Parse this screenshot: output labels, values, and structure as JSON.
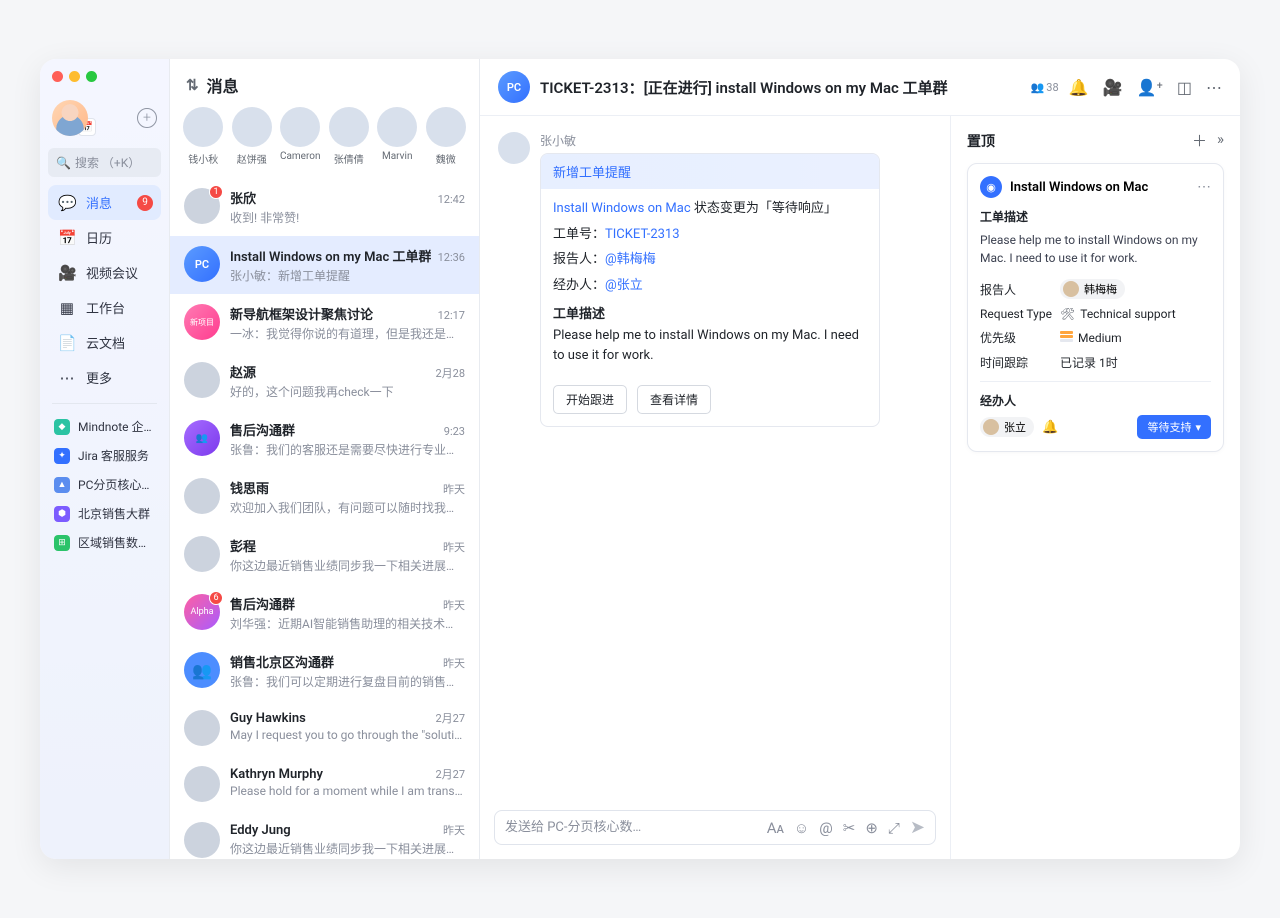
{
  "nav": {
    "search_placeholder": "搜索 （+K）",
    "items": [
      {
        "label": "消息",
        "icon": "💬",
        "badge": "9",
        "active": true
      },
      {
        "label": "日历",
        "icon": "📅"
      },
      {
        "label": "视频会议",
        "icon": "🎥"
      },
      {
        "label": "工作台",
        "icon": "▦"
      },
      {
        "label": "云文档",
        "icon": "📄"
      },
      {
        "label": "更多",
        "icon": "⋯"
      }
    ],
    "apps": [
      {
        "label": "Mindnote 企…",
        "color": "#2bc3a3",
        "ch": "◆"
      },
      {
        "label": "Jira 客服服务",
        "color": "#3370ff",
        "ch": "✦"
      },
      {
        "label": "PC分页核心…",
        "color": "#5b8def",
        "ch": "▲"
      },
      {
        "label": "北京销售大群",
        "color": "#7c5cff",
        "ch": "⬢"
      },
      {
        "label": "区域销售数…",
        "color": "#2bc36a",
        "ch": "⊞"
      }
    ]
  },
  "convos": {
    "header": "消息",
    "stories": [
      {
        "name": "钱小秋"
      },
      {
        "name": "赵饼强"
      },
      {
        "name": "Cameron"
      },
      {
        "name": "张倩倩"
      },
      {
        "name": "Marvin"
      },
      {
        "name": "魏微"
      }
    ],
    "list": [
      {
        "avatar": "p",
        "badge": "1",
        "title": "张欣",
        "time": "12:42",
        "sub": "收到! 非常赞!"
      },
      {
        "avatar": "pc",
        "pcText": "PC",
        "title": "Install Windows on my Mac 工单群",
        "time": "12:36",
        "sub": "张小敏：新增工单提醒",
        "active": true
      },
      {
        "avatar": "pink",
        "pcText": "新项目",
        "title": "新导航框架设计聚焦讨论",
        "time": "12:17",
        "sub": "一冰：我觉得你说的有道理，但是我还是坚持…"
      },
      {
        "avatar": "p",
        "title": "赵源",
        "time": "2月28",
        "sub": "好的，这个问题我再check一下"
      },
      {
        "avatar": "grp",
        "pcText": "👥",
        "title": "售后沟通群",
        "time": "9:23",
        "sub": "张鲁：我们的客服还是需要尽快进行专业培训…"
      },
      {
        "avatar": "p",
        "title": "钱思雨",
        "time": "昨天",
        "sub": "欢迎加入我们团队，有问题可以随时找我…"
      },
      {
        "avatar": "p",
        "title": "彭程",
        "time": "昨天",
        "sub": "你这边最近销售业绩同步我一下相关进展…"
      },
      {
        "avatar": "alpha",
        "pcText": "Alpha",
        "badge": "6",
        "title": "售后沟通群",
        "time": "昨天",
        "sub": "刘华强：近期AI智能销售助理的相关技术谁有…"
      },
      {
        "avatar": "blue",
        "pcText": "👥",
        "title": "销售北京区沟通群",
        "time": "昨天",
        "sub": "张鲁：我们可以定期进行复盘目前的销售进展…"
      },
      {
        "avatar": "p",
        "title": "Guy Hawkins",
        "time": "2月27",
        "sub": "May I request you to go through the \"solutions\"…"
      },
      {
        "avatar": "p",
        "title": "Kathryn Murphy",
        "time": "2月27",
        "sub": "Please hold for a moment while I am transferrin…"
      },
      {
        "avatar": "p",
        "title": "Eddy Jung",
        "time": "昨天",
        "sub": "你这边最近销售业绩同步我一下相关进展…"
      }
    ]
  },
  "chat": {
    "avatar_text": "PC",
    "title": "TICKET-2313：[正在进行] install Windows on my Mac 工单群",
    "member_count": "38",
    "message": {
      "sender": "张小敏",
      "card_title": "新增工单提醒",
      "line1_link": "Install Windows on Mac",
      "line1_rest": " 状态变更为「等待响应」",
      "ticket_label": "工单号：",
      "ticket_val": "TICKET-2313",
      "reporter_label": "报告人：",
      "reporter_val": "@韩梅梅",
      "handler_label": "经办人：",
      "handler_val": "@张立",
      "desc_label": "工单描述",
      "desc_text": "Please help me to install Windows on my Mac. I need to use it for work.",
      "btn1": "开始跟进",
      "btn2": "查看详情"
    },
    "composer_placeholder": "发送给 PC-分页核心数…"
  },
  "panel": {
    "title": "置顶",
    "ticket": {
      "title": "Install Windows on Mac",
      "desc_label": "工单描述",
      "desc_text": "Please help me to install Windows on my Mac. I need to use it for work.",
      "fields": {
        "reporter_label": "报告人",
        "reporter_val": "韩梅梅",
        "type_label": "Request Type",
        "type_val": "Technical support",
        "priority_label": "优先级",
        "priority_val": "Medium",
        "track_label": "时间跟踪",
        "track_val": "已记录 1时"
      },
      "assignee_label": "经办人",
      "assignee_val": "张立",
      "status": "等待支持"
    }
  }
}
